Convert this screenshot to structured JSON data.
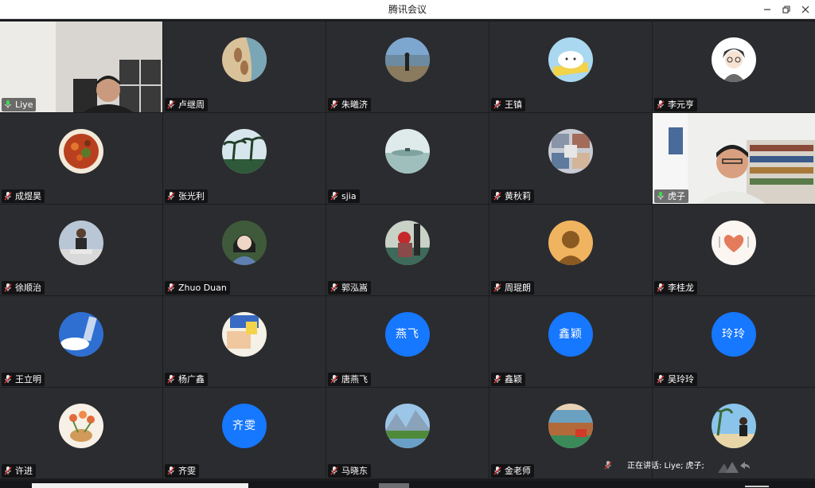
{
  "window": {
    "title": "腾讯会议"
  },
  "participants": [
    {
      "name": "Liye",
      "kind": "video",
      "mic": "on",
      "active": true
    },
    {
      "name": "卢继周",
      "kind": "photo",
      "photo": "sand-footprints"
    },
    {
      "name": "朱曦济",
      "kind": "photo",
      "photo": "lake-person"
    },
    {
      "name": "王镇",
      "kind": "photo",
      "photo": "cartoon-cat"
    },
    {
      "name": "李元亨",
      "kind": "photo",
      "photo": "cartoon-boy"
    },
    {
      "name": "成煜昊",
      "kind": "photo",
      "photo": "food-dish"
    },
    {
      "name": "张光利",
      "kind": "photo",
      "photo": "palm-trees"
    },
    {
      "name": "sjia",
      "kind": "photo",
      "photo": "misty-lake"
    },
    {
      "name": "黄秋莉",
      "kind": "photo",
      "photo": "collage"
    },
    {
      "name": "虎子",
      "kind": "video",
      "mic": "on"
    },
    {
      "name": "徐顺治",
      "kind": "photo",
      "photo": "man-sitting"
    },
    {
      "name": "Zhuo Duan",
      "kind": "photo",
      "photo": "girl-portrait"
    },
    {
      "name": "郭泓嵩",
      "kind": "photo",
      "photo": "red-character"
    },
    {
      "name": "周琨朗",
      "kind": "photo",
      "photo": "default-avatar"
    },
    {
      "name": "李桂龙",
      "kind": "photo",
      "photo": "heart-drawing"
    },
    {
      "name": "王立明",
      "kind": "photo",
      "photo": "blue-sky"
    },
    {
      "name": "杨广鑫",
      "kind": "photo",
      "photo": "hand-drawing"
    },
    {
      "name": "唐燕飞",
      "kind": "text",
      "avatar_text": "燕飞"
    },
    {
      "name": "鑫颖",
      "kind": "text",
      "avatar_text": "鑫颖"
    },
    {
      "name": "吴玲玲",
      "kind": "text",
      "avatar_text": "玲玲"
    },
    {
      "name": "许进",
      "kind": "photo",
      "photo": "tulips"
    },
    {
      "name": "齐雯",
      "kind": "text",
      "avatar_text": "齐雯"
    },
    {
      "name": "马晓东",
      "kind": "photo",
      "photo": "mountain-lake"
    },
    {
      "name": "金老师",
      "kind": "photo",
      "photo": "coast"
    },
    {
      "name": "",
      "kind": "photo",
      "photo": "beach-girl",
      "no_tag": true
    }
  ],
  "status": {
    "speaking": "正在讲话: Liye; 虎子;"
  },
  "colors": {
    "avatar_blue": "#1677ff",
    "tile_bg": "#2b2c2f",
    "active_border": "#2f9b4b",
    "mic_muted": "#e53935",
    "mic_on": "#3ddc4f"
  }
}
